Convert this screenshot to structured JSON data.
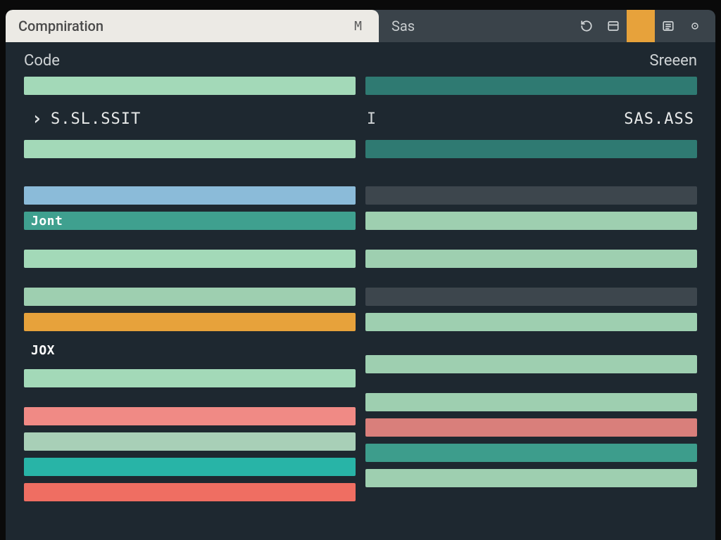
{
  "tabs": {
    "active": {
      "title": "Compniration",
      "suffix": "M"
    },
    "inactive": {
      "title": "Sas"
    }
  },
  "toolbar": {
    "refresh_icon": "refresh",
    "panel_icon": "panel",
    "highlighted_icon": "highlight",
    "list_icon": "list",
    "more_icon": "more"
  },
  "headers": {
    "left": "Code",
    "right": "Sreeen"
  },
  "selector": {
    "chevron": "›",
    "left_text": "S.SL.SSIT",
    "separator": "I",
    "right_text": "SAS.ASS"
  },
  "left_rows": [
    {
      "color": "c-mint",
      "label": ""
    },
    {
      "type": "selector"
    },
    {
      "color": "c-mint",
      "label": ""
    },
    {
      "type": "gap-lg"
    },
    {
      "color": "c-sky",
      "label": ""
    },
    {
      "color": "c-teal",
      "label": "Jont"
    },
    {
      "type": "gap-md"
    },
    {
      "color": "c-mint",
      "label": ""
    },
    {
      "type": "gap-md"
    },
    {
      "color": "c-mintmut",
      "label": ""
    },
    {
      "color": "c-orange",
      "label": ""
    },
    {
      "color": "c-slate",
      "label": "JOX",
      "text_only": true
    },
    {
      "color": "c-mint",
      "label": ""
    },
    {
      "type": "gap-md"
    },
    {
      "color": "c-pink",
      "label": ""
    },
    {
      "color": "c-mintdim",
      "label": ""
    },
    {
      "color": "c-cyan",
      "label": ""
    },
    {
      "color": "c-red",
      "label": ""
    }
  ],
  "right_rows": [
    {
      "color": "c-tealdk",
      "label": ""
    },
    {
      "type": "selector-right"
    },
    {
      "color": "c-tealdk",
      "label": ""
    },
    {
      "type": "gap-lg"
    },
    {
      "color": "c-slate2",
      "label": ""
    },
    {
      "color": "c-mintmut",
      "label": ""
    },
    {
      "type": "gap-md"
    },
    {
      "color": "c-mintmut",
      "label": ""
    },
    {
      "type": "gap-md"
    },
    {
      "color": "c-slate2",
      "label": ""
    },
    {
      "color": "c-mintmut",
      "label": ""
    },
    {
      "type": "gap-sm"
    },
    {
      "type": "gap-md"
    },
    {
      "color": "c-mintmut",
      "label": ""
    },
    {
      "type": "gap-md"
    },
    {
      "color": "c-mintmut",
      "label": ""
    },
    {
      "color": "c-pinkdim",
      "label": ""
    },
    {
      "color": "c-teal2",
      "label": ""
    },
    {
      "color": "c-mintmut",
      "label": ""
    }
  ]
}
